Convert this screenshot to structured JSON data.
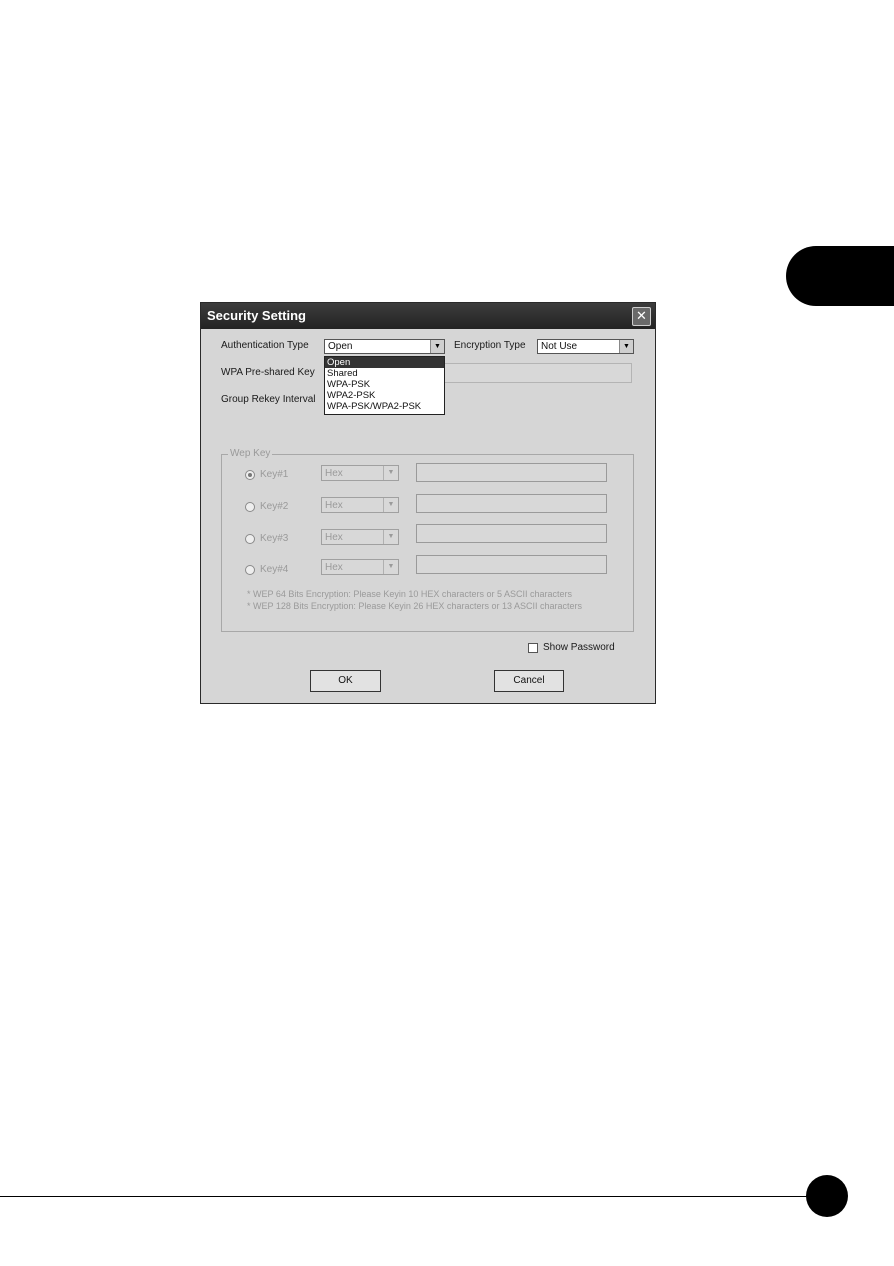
{
  "dialog": {
    "title": "Security Setting",
    "close_glyph": "✕",
    "auth_label": "Authentication Type",
    "auth_value": "Open",
    "auth_options": [
      "Open",
      "Shared",
      "WPA-PSK",
      "WPA2-PSK",
      "WPA-PSK/WPA2-PSK"
    ],
    "encryption_label": "Encryption Type",
    "encryption_value": "Not Use",
    "wpa_key_label": "WPA Pre-shared Key",
    "rekey_label": "Group Rekey Interval",
    "wep_group_label": "Wep Key",
    "keys": [
      {
        "label": "Key#1",
        "format": "Hex",
        "selected": true
      },
      {
        "label": "Key#2",
        "format": "Hex",
        "selected": false
      },
      {
        "label": "Key#3",
        "format": "Hex",
        "selected": false
      },
      {
        "label": "Key#4",
        "format": "Hex",
        "selected": false
      }
    ],
    "note_64": "* WEP 64 Bits Encryption:  Please Keyin 10 HEX characters or 5 ASCII characters",
    "note_128": "* WEP 128 Bits Encryption:  Please Keyin 26 HEX characters or 13 ASCII characters",
    "show_password_label": "Show Password",
    "ok_label": "OK",
    "cancel_label": "Cancel",
    "dropdown_arrow": "▼"
  },
  "colors": {
    "titlebar": "#2e2e2e",
    "dialog_bg": "#d6d6d6",
    "selected_item": "#333333"
  }
}
